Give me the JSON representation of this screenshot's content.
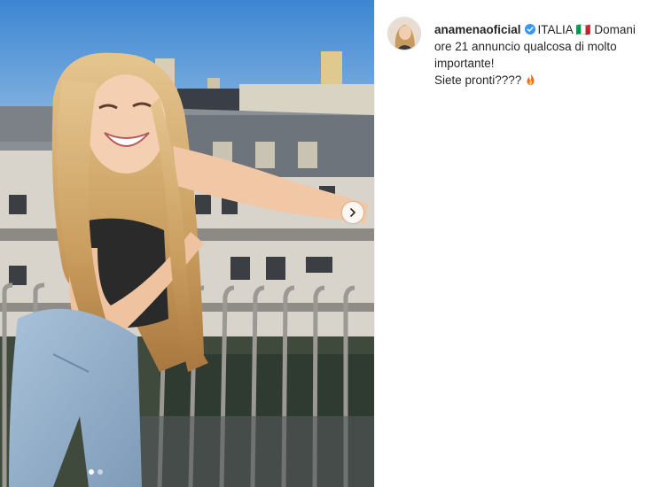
{
  "post": {
    "username": "anamenaoficial",
    "caption_line1": "ITALIA 🇮🇹 Domani ore 21 annuncio qualcosa di molto importante!",
    "caption_line2": "Siete pronti????",
    "caption_emoji": "fire-icon",
    "verified_icon": "verified-badge-icon"
  },
  "carousel": {
    "current_slide": 1,
    "total_slides": 2,
    "next_icon": "chevron-right-icon"
  },
  "colors": {
    "verified_blue": "#3897f0",
    "text": "#262626",
    "sky": "#4f93d6",
    "hair": "#d7b27a"
  }
}
